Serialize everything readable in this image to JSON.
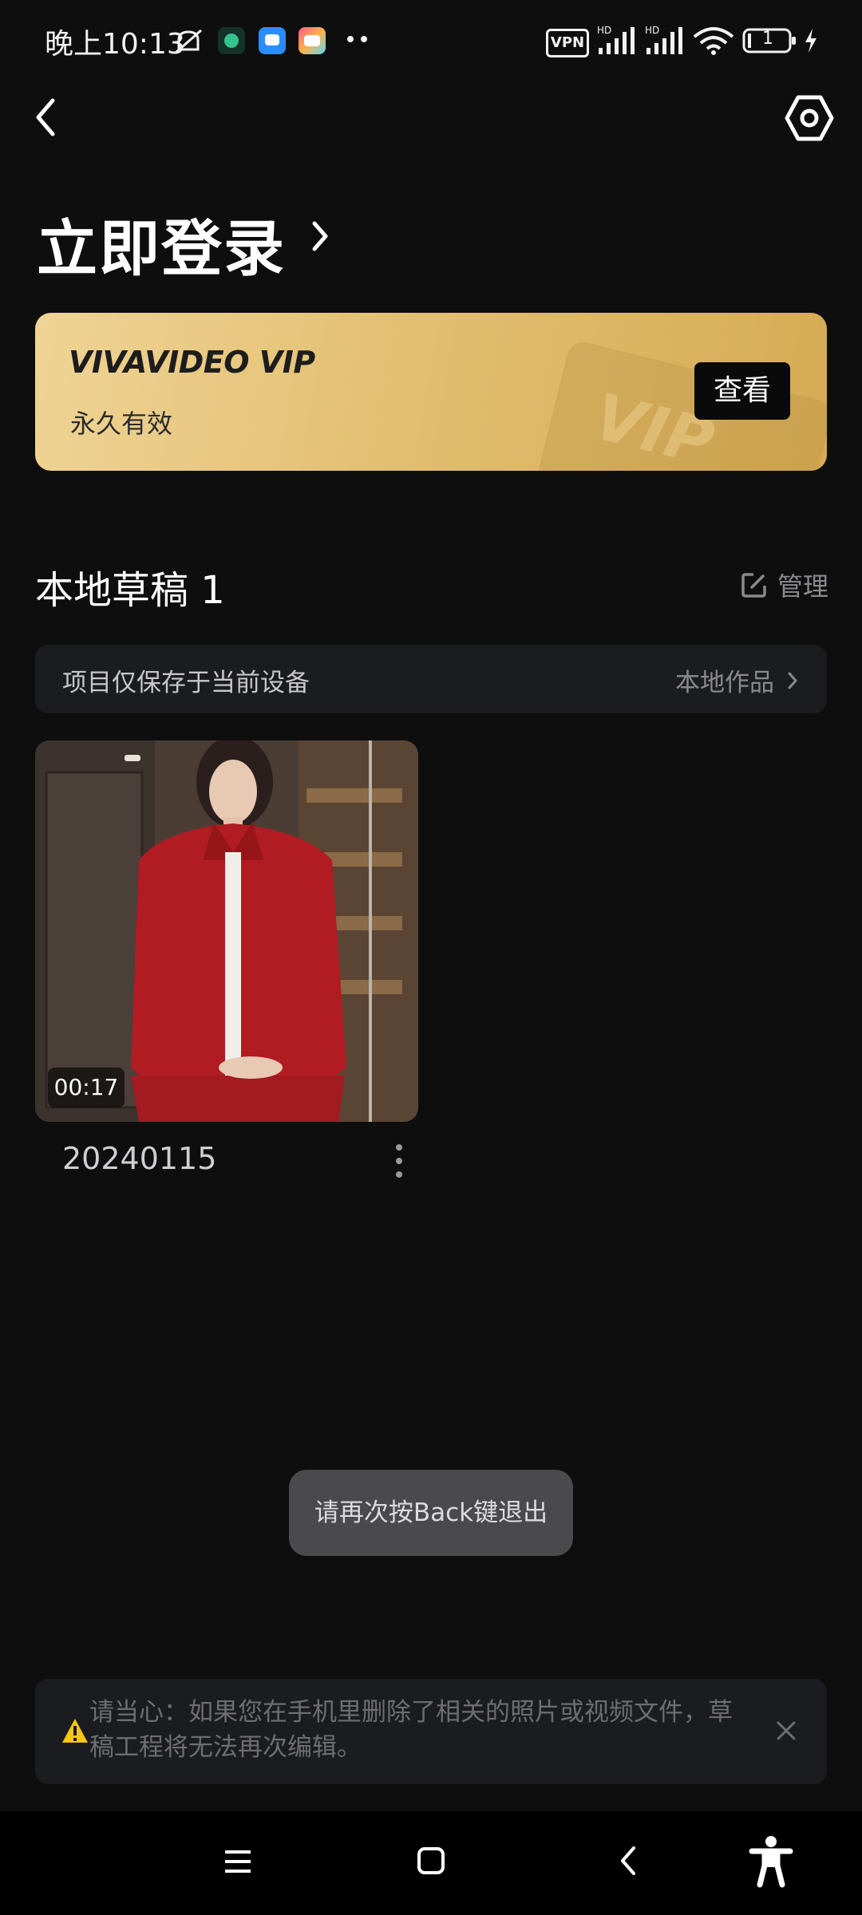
{
  "status_bar": {
    "time": "晚上10:13",
    "vpn_label": "VPN",
    "battery_level": "1",
    "icons": [
      "mute-notification-icon",
      "app-notification-icon",
      "message-app-icon",
      "bilibili-app-icon",
      "more-dots-icon",
      "signal-icon",
      "signal-icon",
      "wifi-icon",
      "battery-icon",
      "charging-icon"
    ]
  },
  "header": {
    "back_icon": "chevron-left-icon",
    "settings_icon": "gear-icon",
    "login_title": "立即登录"
  },
  "vip_card": {
    "brand": "VIVAVIDEO VIP",
    "validity": "永久有效",
    "view_button": "查看",
    "deco_text": "VIP"
  },
  "drafts": {
    "title": "本地草稿 1",
    "manage_label": "管理",
    "info_text": "项目仅保存于当前设备",
    "local_works_label": "本地作品",
    "items": [
      {
        "duration": "00:17",
        "name": "20240115"
      }
    ]
  },
  "toast": {
    "text": "请再次按Back键退出"
  },
  "warning": {
    "text": "请当心：如果您在手机里删除了相关的照片或视频文件，草稿工程将无法再次编辑。"
  },
  "nav_bar": {
    "icons": [
      "menu-icon",
      "home-icon",
      "back-icon",
      "accessibility-icon"
    ]
  },
  "colors": {
    "background": "#0e0e0f",
    "vip_gold": "#e3bf72",
    "card_bg": "#1b1c1f",
    "warning_yellow": "#f5c518"
  }
}
